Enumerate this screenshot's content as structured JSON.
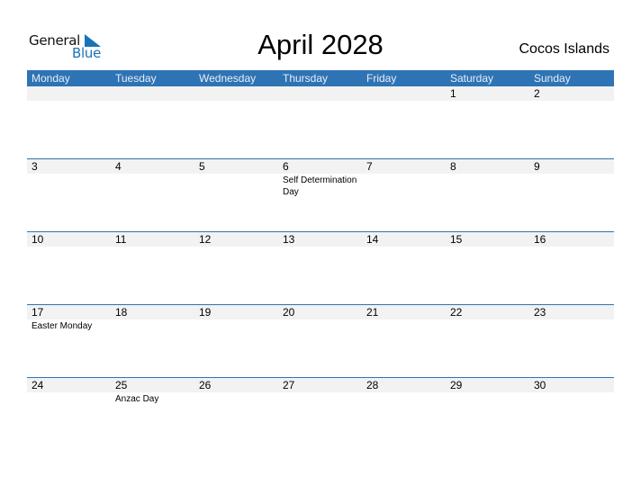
{
  "logo": {
    "line1": "General",
    "line2": "Blue"
  },
  "title": "April 2028",
  "country": "Cocos Islands",
  "weekdays": [
    "Monday",
    "Tuesday",
    "Wednesday",
    "Thursday",
    "Friday",
    "Saturday",
    "Sunday"
  ],
  "weeks": [
    [
      {
        "d": ""
      },
      {
        "d": ""
      },
      {
        "d": ""
      },
      {
        "d": ""
      },
      {
        "d": ""
      },
      {
        "d": "1"
      },
      {
        "d": "2"
      }
    ],
    [
      {
        "d": "3"
      },
      {
        "d": "4"
      },
      {
        "d": "5"
      },
      {
        "d": "6",
        "h": "Self Determination Day"
      },
      {
        "d": "7"
      },
      {
        "d": "8"
      },
      {
        "d": "9"
      }
    ],
    [
      {
        "d": "10"
      },
      {
        "d": "11"
      },
      {
        "d": "12"
      },
      {
        "d": "13"
      },
      {
        "d": "14"
      },
      {
        "d": "15"
      },
      {
        "d": "16"
      }
    ],
    [
      {
        "d": "17",
        "h": "Easter Monday"
      },
      {
        "d": "18"
      },
      {
        "d": "19"
      },
      {
        "d": "20"
      },
      {
        "d": "21"
      },
      {
        "d": "22"
      },
      {
        "d": "23"
      }
    ],
    [
      {
        "d": "24"
      },
      {
        "d": "25",
        "h": "Anzac Day"
      },
      {
        "d": "26"
      },
      {
        "d": "27"
      },
      {
        "d": "28"
      },
      {
        "d": "29"
      },
      {
        "d": "30"
      }
    ]
  ],
  "colors": {
    "accent": "#2e74b5",
    "band": "#f2f2f2"
  }
}
